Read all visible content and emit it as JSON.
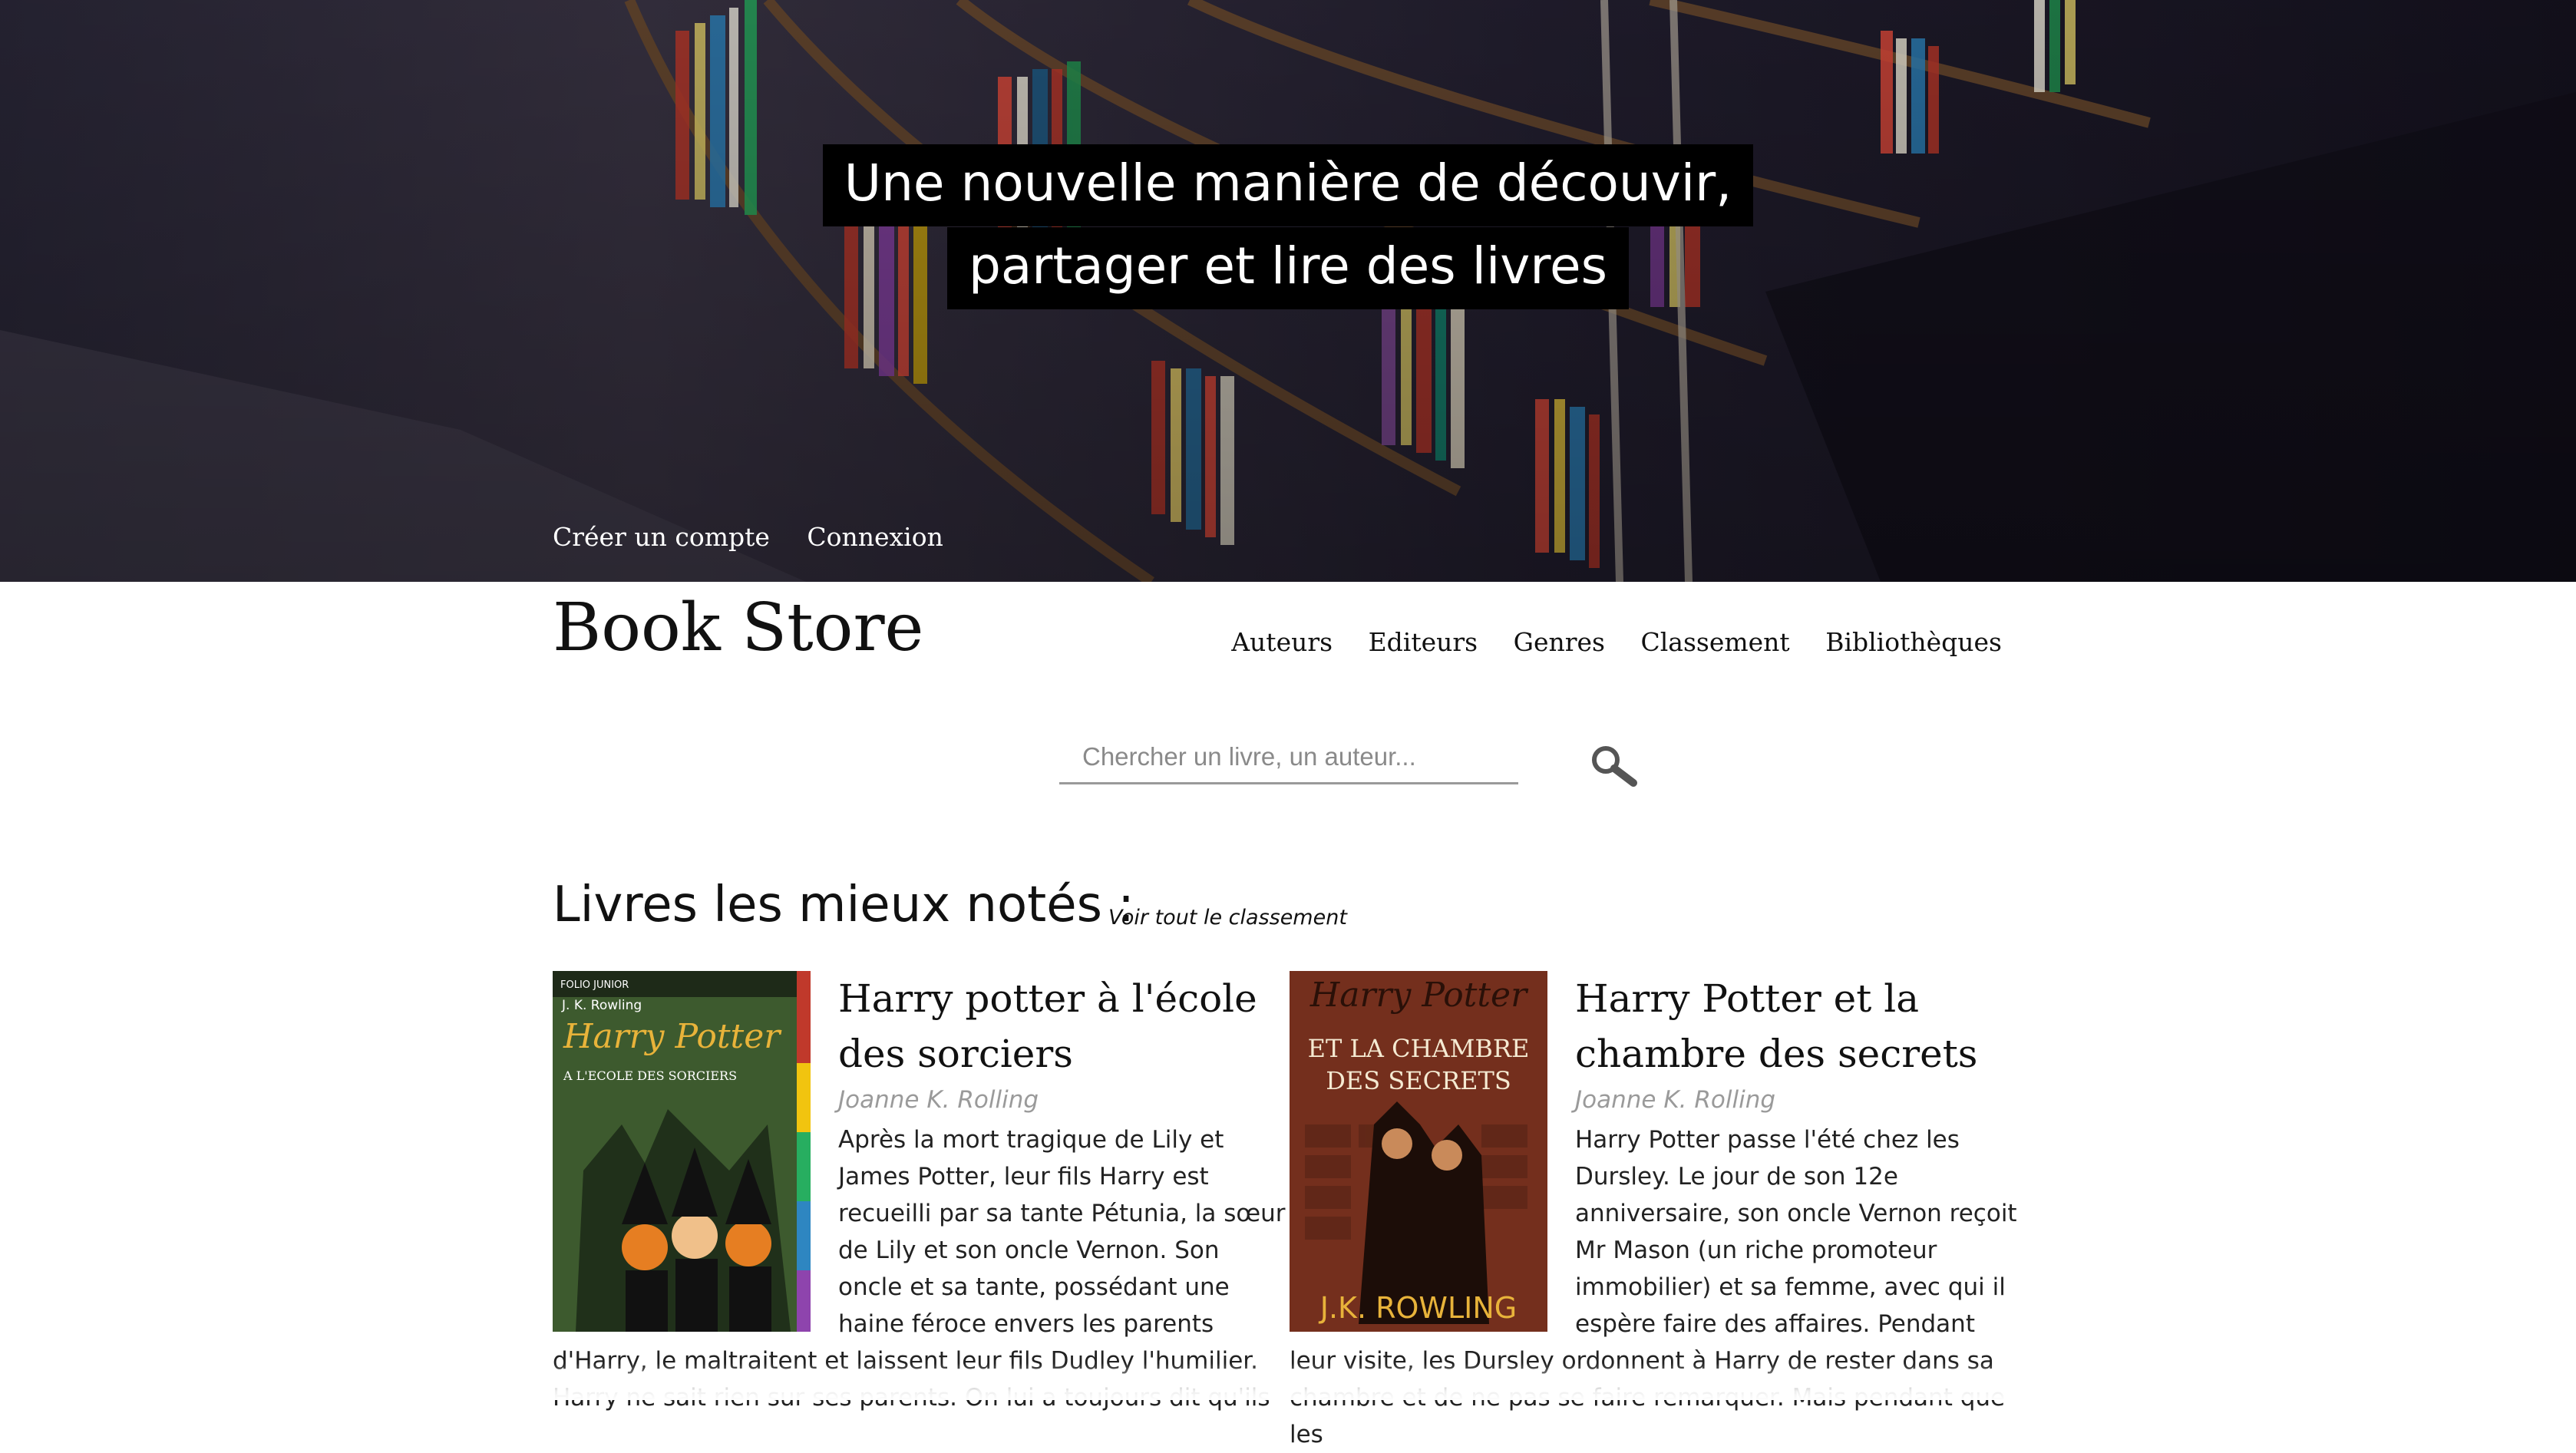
{
  "hero": {
    "tagline_line1": "Une nouvelle manière de découvir,",
    "tagline_line2": "partager et lire des livres",
    "account_links": {
      "create_account": "Créer un compte",
      "login": "Connexion"
    }
  },
  "header": {
    "brand": "Book Store",
    "nav": [
      "Auteurs",
      "Editeurs",
      "Genres",
      "Classement",
      "Bibliothèques"
    ]
  },
  "search": {
    "placeholder": "Chercher un livre, un auteur...",
    "button_icon": "search-icon"
  },
  "section": {
    "title": "Livres les mieux notés :",
    "see_all": "Voir tout le classement"
  },
  "books": [
    {
      "title": "Harry potter à l'école des sorciers",
      "author": "Joanne K. Rolling",
      "description": "Après la mort tragique de Lily et James Potter, leur fils Harry est recueilli par sa tante Pétunia, la sœur de Lily et son oncle Vernon. Son oncle et sa tante, possédant une haine féroce envers les parents d'Harry, le maltraitent et laissent leur fils Dudley l'humilier. Harry ne sait rien sur ses parents. On lui a toujours dit qu'ils",
      "cover": {
        "publisher": "FOLIO JUNIOR",
        "author": "J. K. Rowling",
        "series": "Harry Potter",
        "subtitle": "A L'ECOLE DES SORCIERS"
      }
    },
    {
      "title": "Harry Potter et la chambre des secrets",
      "author": "Joanne K. Rolling",
      "description": "Harry Potter passe l'été chez les Dursley. Le jour de son 12e anniversaire, son oncle Vernon reçoit Mr Mason (un riche promoteur immobilier) et sa femme, avec qui il espère faire des affaires. Pendant leur visite, les Dursley ordonnent à Harry de rester dans sa chambre et de ne pas se faire remarquer. Mais pendant que les",
      "cover": {
        "series": "Harry Potter",
        "subtitle_line1": "ET LA CHAMBRE",
        "subtitle_line2": "DES SECRETS",
        "author": "J.K. ROWLING"
      }
    }
  ],
  "colors": {
    "hero_dark": "#1b1a2e",
    "tagline_bg": "#000000",
    "text": "#111111",
    "author_grey": "#9a9a9a",
    "search_underline": "#9a9a9a"
  }
}
